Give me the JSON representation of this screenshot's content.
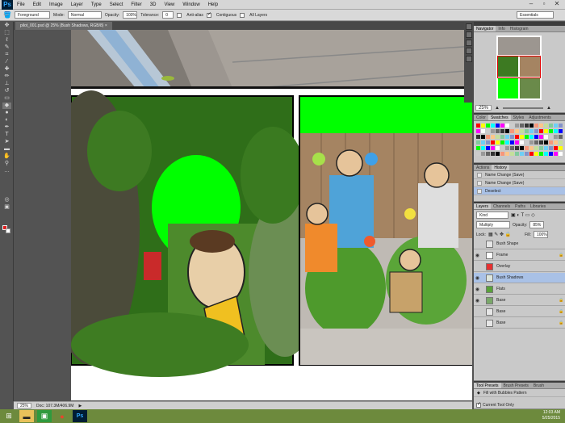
{
  "app": {
    "logo": "Ps",
    "menu": [
      "File",
      "Edit",
      "Image",
      "Layer",
      "Type",
      "Select",
      "Filter",
      "3D",
      "View",
      "Window",
      "Help"
    ]
  },
  "options_bar": {
    "fill_source": "Foreground",
    "mode_label": "Mode:",
    "mode_value": "Normal",
    "opacity_label": "Opacity:",
    "opacity_value": "100%",
    "tolerance_label": "Tolerance:",
    "tolerance_value": "0",
    "anti_alias_label": "Anti-alias",
    "contiguous_label": "Contiguous",
    "all_layers_label": "All Layers",
    "workspace": "Essentials"
  },
  "document": {
    "tab_title": "pilot_001.psd @ 25% (Bush Shadows, RGB/8) ×"
  },
  "status_bar": {
    "zoom": "25%",
    "doc_info": "Doc: 107.3M/406.9M"
  },
  "navigator": {
    "tabs": [
      "Navigator",
      "Info",
      "Histogram"
    ],
    "zoom": "25%"
  },
  "swatches": {
    "tabs": [
      "Color",
      "Swatches",
      "Styles",
      "Adjustments"
    ]
  },
  "history": {
    "tabs": [
      "Actions",
      "History"
    ],
    "items": [
      "Name Change (Save)",
      "Name Change (Save)",
      "Deselect"
    ]
  },
  "layers": {
    "tabs": [
      "Layers",
      "Channels",
      "Paths",
      "Libraries"
    ],
    "kind_label": "Kind",
    "blend_mode": "Multiply",
    "opacity_label": "Opacity:",
    "opacity_value": "85%",
    "lock_label": "Lock:",
    "fill_label": "Fill:",
    "fill_value": "100%",
    "items": [
      {
        "name": "Bush Shape",
        "visible": false,
        "thumb": "#e6e6e6",
        "locked": false
      },
      {
        "name": "Frame",
        "visible": true,
        "thumb": "#ffffff",
        "locked": true
      },
      {
        "name": "Overlay",
        "visible": false,
        "thumb": "#e63030",
        "locked": false
      },
      {
        "name": "Bush Shadows",
        "visible": true,
        "thumb": "#dde6dd",
        "locked": false
      },
      {
        "name": "Flats",
        "visible": true,
        "thumb": "#59a23a",
        "locked": false
      },
      {
        "name": "Base",
        "visible": true,
        "thumb": "#7aa86a",
        "locked": true
      },
      {
        "name": "Base",
        "visible": false,
        "thumb": "#e6e6e6",
        "locked": true
      },
      {
        "name": "Base",
        "visible": false,
        "thumb": "#e6e6e6",
        "locked": true
      }
    ]
  },
  "tool_presets": {
    "tabs": [
      "Tool Presets",
      "Brush Presets",
      "Brush"
    ],
    "item": "Fill with Bubbles Pattern",
    "current_tool_only": "Current Tool Only"
  },
  "taskbar": {
    "time": "12:03 AM",
    "date": "5/25/2015"
  },
  "colors": {
    "foreground": "#e02020",
    "background": "#ffffff",
    "green_fill": "#00ff00"
  }
}
